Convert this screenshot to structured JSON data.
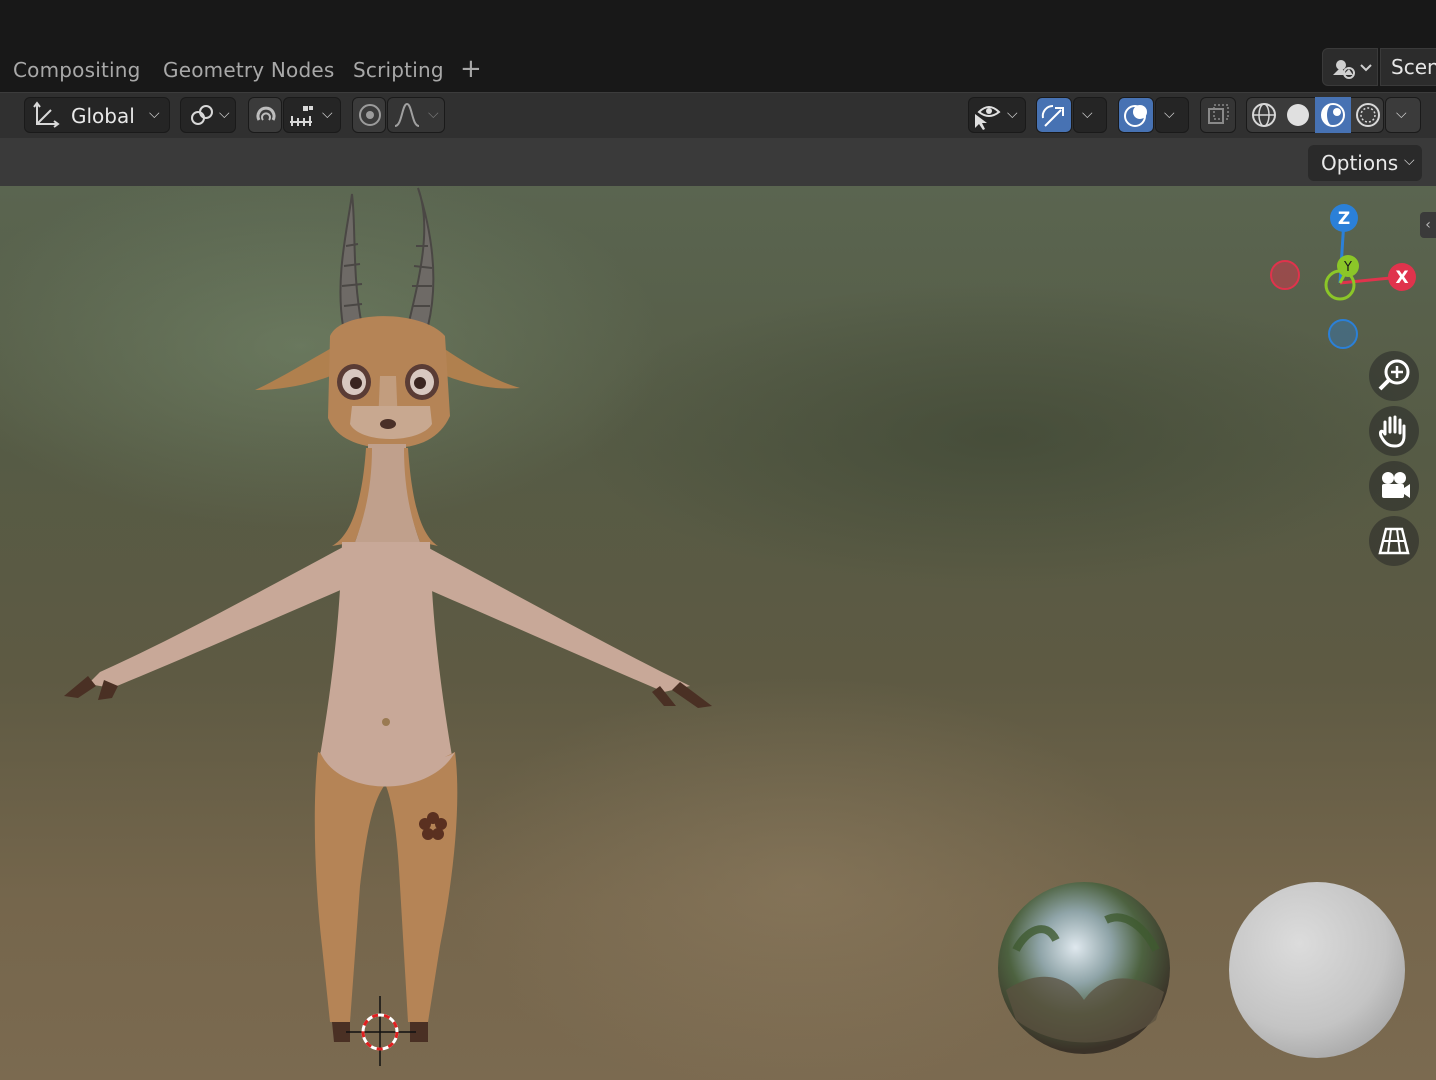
{
  "workspace_tabs": [
    "Compositing",
    "Geometry Nodes",
    "Scripting"
  ],
  "add_workspace_label": "+",
  "scene": {
    "name": "Scen"
  },
  "toolbar": {
    "transform_orientation": "Global",
    "options_label": "Options"
  },
  "navigation_gizmo": {
    "z": "Z",
    "x": "X",
    "y": "Y"
  },
  "colors": {
    "accent_blue": "#4772b3",
    "axis_x": "#e0334c",
    "axis_y": "#8bc628",
    "axis_z": "#2b80d8"
  },
  "icons": {
    "viewport_tools": [
      "zoom-icon",
      "pan-hand-icon",
      "camera-view-icon",
      "perspective-grid-icon"
    ],
    "shading_modes": [
      "wireframe-icon",
      "solid-icon",
      "material-preview-icon",
      "rendered-icon"
    ]
  }
}
